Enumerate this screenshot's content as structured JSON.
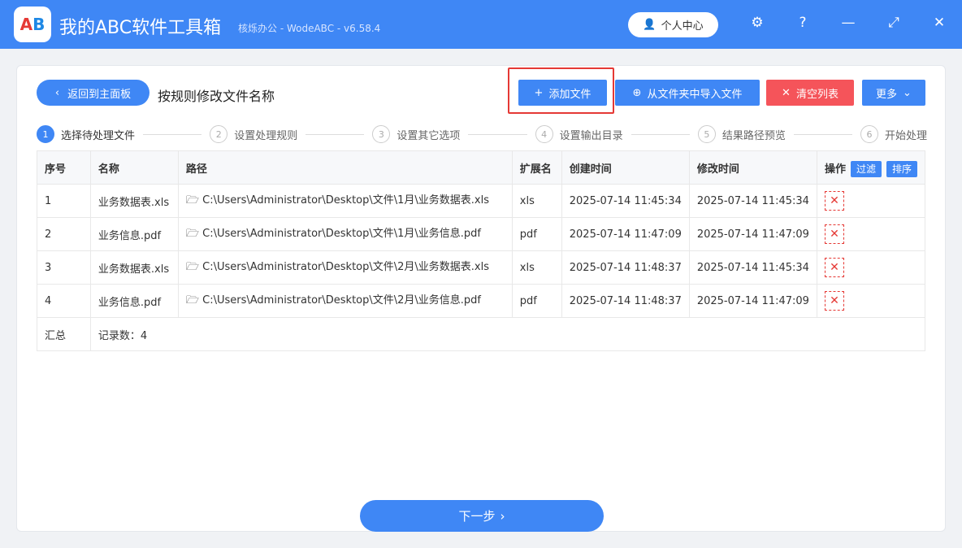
{
  "app": {
    "title": "我的ABC软件工具箱",
    "subtitle": "核烁办公 - WodeABC - v6.58.4",
    "user_center": "个人中心"
  },
  "toolbar": {
    "back": "返回到主面板",
    "page_title": "按规则修改文件名称",
    "add_file": "添加文件",
    "import_folder": "从文件夹中导入文件",
    "clear_list": "清空列表",
    "more": "更多"
  },
  "steps": [
    "选择待处理文件",
    "设置处理规则",
    "设置其它选项",
    "设置输出目录",
    "结果路径预览",
    "开始处理"
  ],
  "table": {
    "headers": [
      "序号",
      "名称",
      "路径",
      "扩展名",
      "创建时间",
      "修改时间",
      "操作"
    ],
    "filter": "过滤",
    "sort": "排序",
    "rows": [
      [
        "1",
        "业务数据表.xls",
        "C:\\Users\\Administrator\\Desktop\\文件\\1月\\业务数据表.xls",
        "xls",
        "2025-07-14 11:45:34",
        "2025-07-14 11:45:34"
      ],
      [
        "2",
        "业务信息.pdf",
        "C:\\Users\\Administrator\\Desktop\\文件\\1月\\业务信息.pdf",
        "pdf",
        "2025-07-14 11:47:09",
        "2025-07-14 11:47:09"
      ],
      [
        "3",
        "业务数据表.xls",
        "C:\\Users\\Administrator\\Desktop\\文件\\2月\\业务数据表.xls",
        "xls",
        "2025-07-14 11:48:37",
        "2025-07-14 11:45:34"
      ],
      [
        "4",
        "业务信息.pdf",
        "C:\\Users\\Administrator\\Desktop\\文件\\2月\\业务信息.pdf",
        "pdf",
        "2025-07-14 11:48:37",
        "2025-07-14 11:47:09"
      ]
    ],
    "summary_label": "汇总",
    "summary_count": "记录数：4"
  },
  "next": "下一步"
}
